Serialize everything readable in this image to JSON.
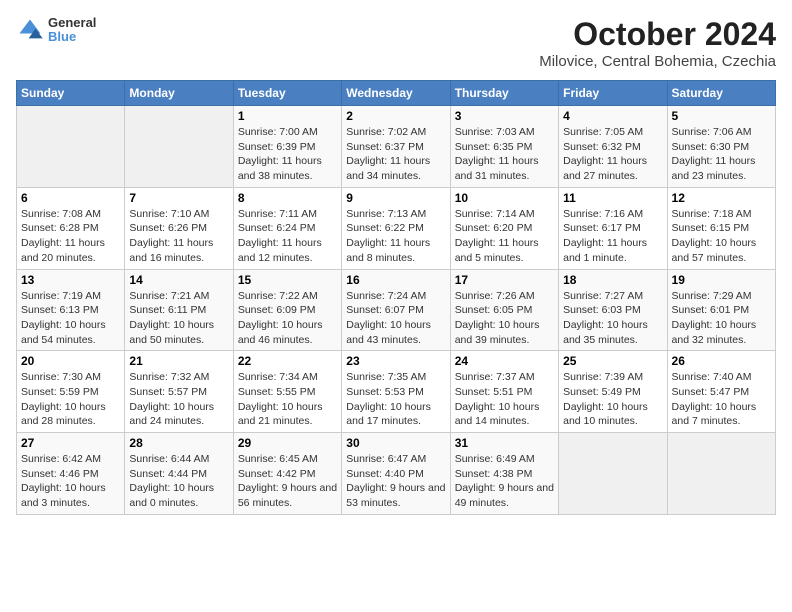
{
  "header": {
    "logo": {
      "line1": "General",
      "line2": "Blue"
    },
    "title": "October 2024",
    "subtitle": "Milovice, Central Bohemia, Czechia"
  },
  "weekdays": [
    "Sunday",
    "Monday",
    "Tuesday",
    "Wednesday",
    "Thursday",
    "Friday",
    "Saturday"
  ],
  "weeks": [
    [
      {
        "day": "",
        "sunrise": "",
        "sunset": "",
        "daylight": "",
        "empty": true
      },
      {
        "day": "",
        "sunrise": "",
        "sunset": "",
        "daylight": "",
        "empty": true
      },
      {
        "day": "1",
        "sunrise": "Sunrise: 7:00 AM",
        "sunset": "Sunset: 6:39 PM",
        "daylight": "Daylight: 11 hours and 38 minutes.",
        "empty": false
      },
      {
        "day": "2",
        "sunrise": "Sunrise: 7:02 AM",
        "sunset": "Sunset: 6:37 PM",
        "daylight": "Daylight: 11 hours and 34 minutes.",
        "empty": false
      },
      {
        "day": "3",
        "sunrise": "Sunrise: 7:03 AM",
        "sunset": "Sunset: 6:35 PM",
        "daylight": "Daylight: 11 hours and 31 minutes.",
        "empty": false
      },
      {
        "day": "4",
        "sunrise": "Sunrise: 7:05 AM",
        "sunset": "Sunset: 6:32 PM",
        "daylight": "Daylight: 11 hours and 27 minutes.",
        "empty": false
      },
      {
        "day": "5",
        "sunrise": "Sunrise: 7:06 AM",
        "sunset": "Sunset: 6:30 PM",
        "daylight": "Daylight: 11 hours and 23 minutes.",
        "empty": false
      }
    ],
    [
      {
        "day": "6",
        "sunrise": "Sunrise: 7:08 AM",
        "sunset": "Sunset: 6:28 PM",
        "daylight": "Daylight: 11 hours and 20 minutes.",
        "empty": false
      },
      {
        "day": "7",
        "sunrise": "Sunrise: 7:10 AM",
        "sunset": "Sunset: 6:26 PM",
        "daylight": "Daylight: 11 hours and 16 minutes.",
        "empty": false
      },
      {
        "day": "8",
        "sunrise": "Sunrise: 7:11 AM",
        "sunset": "Sunset: 6:24 PM",
        "daylight": "Daylight: 11 hours and 12 minutes.",
        "empty": false
      },
      {
        "day": "9",
        "sunrise": "Sunrise: 7:13 AM",
        "sunset": "Sunset: 6:22 PM",
        "daylight": "Daylight: 11 hours and 8 minutes.",
        "empty": false
      },
      {
        "day": "10",
        "sunrise": "Sunrise: 7:14 AM",
        "sunset": "Sunset: 6:20 PM",
        "daylight": "Daylight: 11 hours and 5 minutes.",
        "empty": false
      },
      {
        "day": "11",
        "sunrise": "Sunrise: 7:16 AM",
        "sunset": "Sunset: 6:17 PM",
        "daylight": "Daylight: 11 hours and 1 minute.",
        "empty": false
      },
      {
        "day": "12",
        "sunrise": "Sunrise: 7:18 AM",
        "sunset": "Sunset: 6:15 PM",
        "daylight": "Daylight: 10 hours and 57 minutes.",
        "empty": false
      }
    ],
    [
      {
        "day": "13",
        "sunrise": "Sunrise: 7:19 AM",
        "sunset": "Sunset: 6:13 PM",
        "daylight": "Daylight: 10 hours and 54 minutes.",
        "empty": false
      },
      {
        "day": "14",
        "sunrise": "Sunrise: 7:21 AM",
        "sunset": "Sunset: 6:11 PM",
        "daylight": "Daylight: 10 hours and 50 minutes.",
        "empty": false
      },
      {
        "day": "15",
        "sunrise": "Sunrise: 7:22 AM",
        "sunset": "Sunset: 6:09 PM",
        "daylight": "Daylight: 10 hours and 46 minutes.",
        "empty": false
      },
      {
        "day": "16",
        "sunrise": "Sunrise: 7:24 AM",
        "sunset": "Sunset: 6:07 PM",
        "daylight": "Daylight: 10 hours and 43 minutes.",
        "empty": false
      },
      {
        "day": "17",
        "sunrise": "Sunrise: 7:26 AM",
        "sunset": "Sunset: 6:05 PM",
        "daylight": "Daylight: 10 hours and 39 minutes.",
        "empty": false
      },
      {
        "day": "18",
        "sunrise": "Sunrise: 7:27 AM",
        "sunset": "Sunset: 6:03 PM",
        "daylight": "Daylight: 10 hours and 35 minutes.",
        "empty": false
      },
      {
        "day": "19",
        "sunrise": "Sunrise: 7:29 AM",
        "sunset": "Sunset: 6:01 PM",
        "daylight": "Daylight: 10 hours and 32 minutes.",
        "empty": false
      }
    ],
    [
      {
        "day": "20",
        "sunrise": "Sunrise: 7:30 AM",
        "sunset": "Sunset: 5:59 PM",
        "daylight": "Daylight: 10 hours and 28 minutes.",
        "empty": false
      },
      {
        "day": "21",
        "sunrise": "Sunrise: 7:32 AM",
        "sunset": "Sunset: 5:57 PM",
        "daylight": "Daylight: 10 hours and 24 minutes.",
        "empty": false
      },
      {
        "day": "22",
        "sunrise": "Sunrise: 7:34 AM",
        "sunset": "Sunset: 5:55 PM",
        "daylight": "Daylight: 10 hours and 21 minutes.",
        "empty": false
      },
      {
        "day": "23",
        "sunrise": "Sunrise: 7:35 AM",
        "sunset": "Sunset: 5:53 PM",
        "daylight": "Daylight: 10 hours and 17 minutes.",
        "empty": false
      },
      {
        "day": "24",
        "sunrise": "Sunrise: 7:37 AM",
        "sunset": "Sunset: 5:51 PM",
        "daylight": "Daylight: 10 hours and 14 minutes.",
        "empty": false
      },
      {
        "day": "25",
        "sunrise": "Sunrise: 7:39 AM",
        "sunset": "Sunset: 5:49 PM",
        "daylight": "Daylight: 10 hours and 10 minutes.",
        "empty": false
      },
      {
        "day": "26",
        "sunrise": "Sunrise: 7:40 AM",
        "sunset": "Sunset: 5:47 PM",
        "daylight": "Daylight: 10 hours and 7 minutes.",
        "empty": false
      }
    ],
    [
      {
        "day": "27",
        "sunrise": "Sunrise: 6:42 AM",
        "sunset": "Sunset: 4:46 PM",
        "daylight": "Daylight: 10 hours and 3 minutes.",
        "empty": false
      },
      {
        "day": "28",
        "sunrise": "Sunrise: 6:44 AM",
        "sunset": "Sunset: 4:44 PM",
        "daylight": "Daylight: 10 hours and 0 minutes.",
        "empty": false
      },
      {
        "day": "29",
        "sunrise": "Sunrise: 6:45 AM",
        "sunset": "Sunset: 4:42 PM",
        "daylight": "Daylight: 9 hours and 56 minutes.",
        "empty": false
      },
      {
        "day": "30",
        "sunrise": "Sunrise: 6:47 AM",
        "sunset": "Sunset: 4:40 PM",
        "daylight": "Daylight: 9 hours and 53 minutes.",
        "empty": false
      },
      {
        "day": "31",
        "sunrise": "Sunrise: 6:49 AM",
        "sunset": "Sunset: 4:38 PM",
        "daylight": "Daylight: 9 hours and 49 minutes.",
        "empty": false
      },
      {
        "day": "",
        "sunrise": "",
        "sunset": "",
        "daylight": "",
        "empty": true
      },
      {
        "day": "",
        "sunrise": "",
        "sunset": "",
        "daylight": "",
        "empty": true
      }
    ]
  ]
}
